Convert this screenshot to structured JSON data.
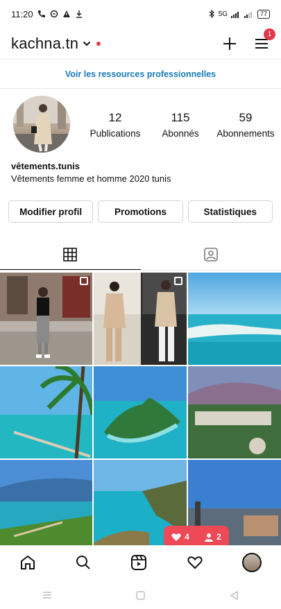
{
  "status": {
    "time": "11:20",
    "signal_text": "5G",
    "battery": "77"
  },
  "header": {
    "username": "kachna.tn",
    "menu_badge": "1"
  },
  "pro_link": "Voir les ressources professionnelles",
  "profile": {
    "stats": [
      {
        "value": "12",
        "label": "Publications"
      },
      {
        "value": "115",
        "label": "Abonnés"
      },
      {
        "value": "59",
        "label": "Abonnements"
      }
    ],
    "name": "vêtements.tunis",
    "bio": "Vêtements femme et homme 2020 tunis"
  },
  "buttons": {
    "edit": "Modifier profil",
    "promotions": "Promotions",
    "stats": "Statistiques"
  },
  "tabs": [
    "grid",
    "tagged"
  ],
  "notification": {
    "likes": "4",
    "followers": "2"
  },
  "colors": {
    "accent_red": "#ed4956",
    "link_blue": "#1a7ab8"
  }
}
